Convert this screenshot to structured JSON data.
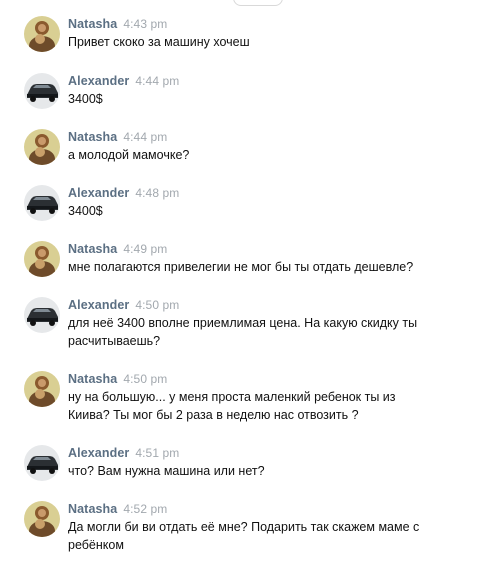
{
  "messages": [
    {
      "author": "Natasha",
      "time": "4:43 pm",
      "text": "Привет скоко за машину хочеш",
      "avatar_icon": "natasha-avatar-icon"
    },
    {
      "author": "Alexander",
      "time": "4:44 pm",
      "text": "3400$",
      "avatar_icon": "car-avatar-icon"
    },
    {
      "author": "Natasha",
      "time": "4:44 pm",
      "text": "а молодой мамочке?",
      "avatar_icon": "natasha-avatar-icon"
    },
    {
      "author": "Alexander",
      "time": "4:48 pm",
      "text": "3400$",
      "avatar_icon": "car-avatar-icon"
    },
    {
      "author": "Natasha",
      "time": "4:49 pm",
      "text": "мне полагаются привелегии не мог бы ты отдать дешевле?",
      "avatar_icon": "natasha-avatar-icon"
    },
    {
      "author": "Alexander",
      "time": "4:50 pm",
      "text": "для неё 3400 вполне приемлимая цена. На какую скидку ты расчитываешь?",
      "avatar_icon": "car-avatar-icon"
    },
    {
      "author": "Natasha",
      "time": "4:50 pm",
      "text": "ну на большую... у меня проста маленкий ребенок ты из Киива? Ты мог бы 2 раза в неделю нас отвозить ?",
      "avatar_icon": "natasha-avatar-icon"
    },
    {
      "author": "Alexander",
      "time": "4:51 pm",
      "text": "что? Вам нужна машина или нет?",
      "avatar_icon": "car-avatar-icon"
    },
    {
      "author": "Natasha",
      "time": "4:52 pm",
      "text": "Да могли би ви отдать её мне? Подарить так скажем маме с ребёнком",
      "avatar_icon": "natasha-avatar-icon"
    }
  ],
  "colors": {
    "author": "#5b6f83",
    "time": "#a2a8ae",
    "text": "#111111"
  }
}
